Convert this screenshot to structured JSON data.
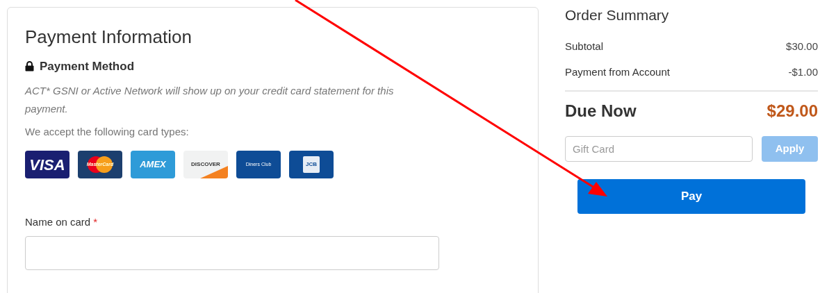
{
  "payment": {
    "title": "Payment Information",
    "method_heading": "Payment Method",
    "statement_note": "ACT* GSNI or Active Network will show up on your credit card statement for this payment.",
    "accept_text": "We accept the following card types:",
    "cards": [
      {
        "kind": "visa",
        "label": "VISA"
      },
      {
        "kind": "mastercard",
        "label": "MasterCard"
      },
      {
        "kind": "amex",
        "label": "AMEX"
      },
      {
        "kind": "discover",
        "label": "DISCOVER"
      },
      {
        "kind": "diners",
        "label": "Diners Club"
      },
      {
        "kind": "jcb",
        "label": "JCB"
      }
    ],
    "name_field": {
      "label": "Name on card",
      "required_mark": "*"
    }
  },
  "summary": {
    "title": "Order Summary",
    "lines": [
      {
        "label": "Subtotal",
        "amount": "$30.00"
      },
      {
        "label": "Payment from Account",
        "amount": "-$1.00"
      }
    ],
    "total": {
      "label": "Due Now",
      "amount": "$29.00"
    },
    "gift_card": {
      "placeholder": "Gift Card",
      "apply_label": "Apply",
      "apply_disabled": true
    },
    "pay_label": "Pay"
  }
}
